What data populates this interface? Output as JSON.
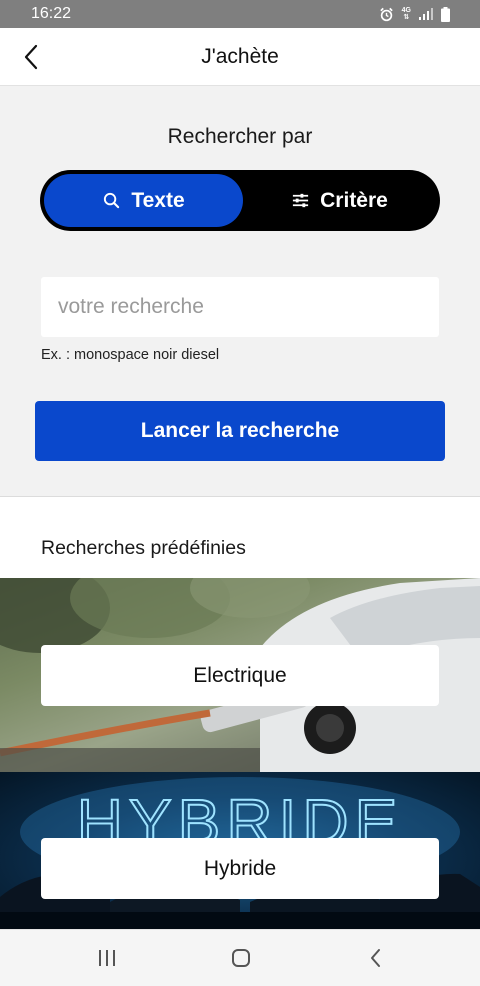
{
  "status_bar": {
    "time": "16:22",
    "network": "4G",
    "icons": [
      "alarm-icon",
      "signal-icon",
      "battery-icon"
    ]
  },
  "header": {
    "title": "J'achète",
    "back_icon": "chevron-left-icon"
  },
  "search": {
    "label": "Rechercher par",
    "modes": [
      {
        "label": "Texte",
        "icon": "search-icon",
        "active": true
      },
      {
        "label": "Critère",
        "icon": "sliders-icon",
        "active": false
      }
    ],
    "input_value": "",
    "input_placeholder": "votre recherche",
    "hint": "Ex. : monospace noir diesel",
    "submit_label": "Lancer la recherche"
  },
  "predefined": {
    "title": "Recherches prédéfinies",
    "items": [
      {
        "label": "Electrique",
        "banner": "electric-car-charging-photo"
      },
      {
        "label": "Hybride",
        "banner": "hybride-neon-cars-photo"
      }
    ],
    "hybrid_banner_text": "HYBRIDE"
  },
  "nav_bar": {
    "buttons": [
      "recent-apps-icon",
      "home-icon",
      "back-icon"
    ]
  },
  "colors": {
    "primary": "#0a48cc",
    "toggle_bg": "#000000",
    "status_bar": "#7f7f7f",
    "page_bg": "#f2f2f2"
  }
}
